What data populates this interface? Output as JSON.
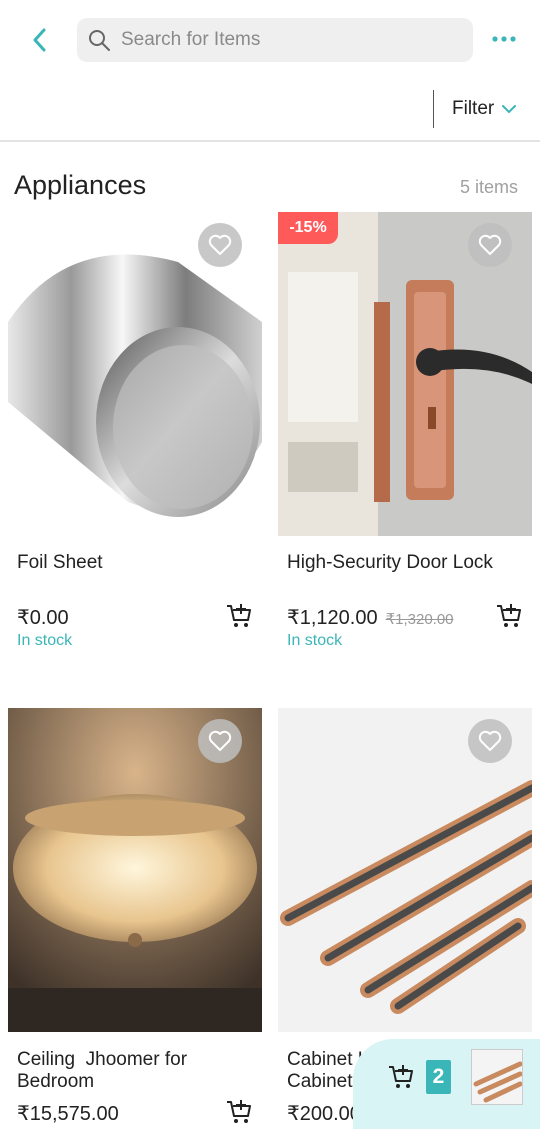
{
  "search": {
    "placeholder": "Search for Items"
  },
  "filter": {
    "label": "Filter"
  },
  "section": {
    "title": "Appliances",
    "count": "5 items"
  },
  "products": [
    {
      "name": "Foil Sheet",
      "price": "₹0.00",
      "old_price": "",
      "stock": "In stock",
      "discount": ""
    },
    {
      "name": "High-Security Door Lock",
      "price": "₹1,120.00",
      "old_price": "₹1,320.00",
      "stock": "In stock",
      "discount": "-15%"
    },
    {
      "name": "Ceiling  Jhoomer for Bedroom",
      "price": "₹15,575.00",
      "old_price": "",
      "stock": "",
      "discount": ""
    },
    {
      "name": "Cabinet Handles for Cabinet",
      "price": "₹200.00",
      "old_price": "",
      "stock": "",
      "discount": ""
    }
  ],
  "cart": {
    "count": "2"
  },
  "colors": {
    "accent": "#3bb6b8",
    "discount": "#ff5a5a",
    "cart_bg": "#d9f4f4"
  }
}
